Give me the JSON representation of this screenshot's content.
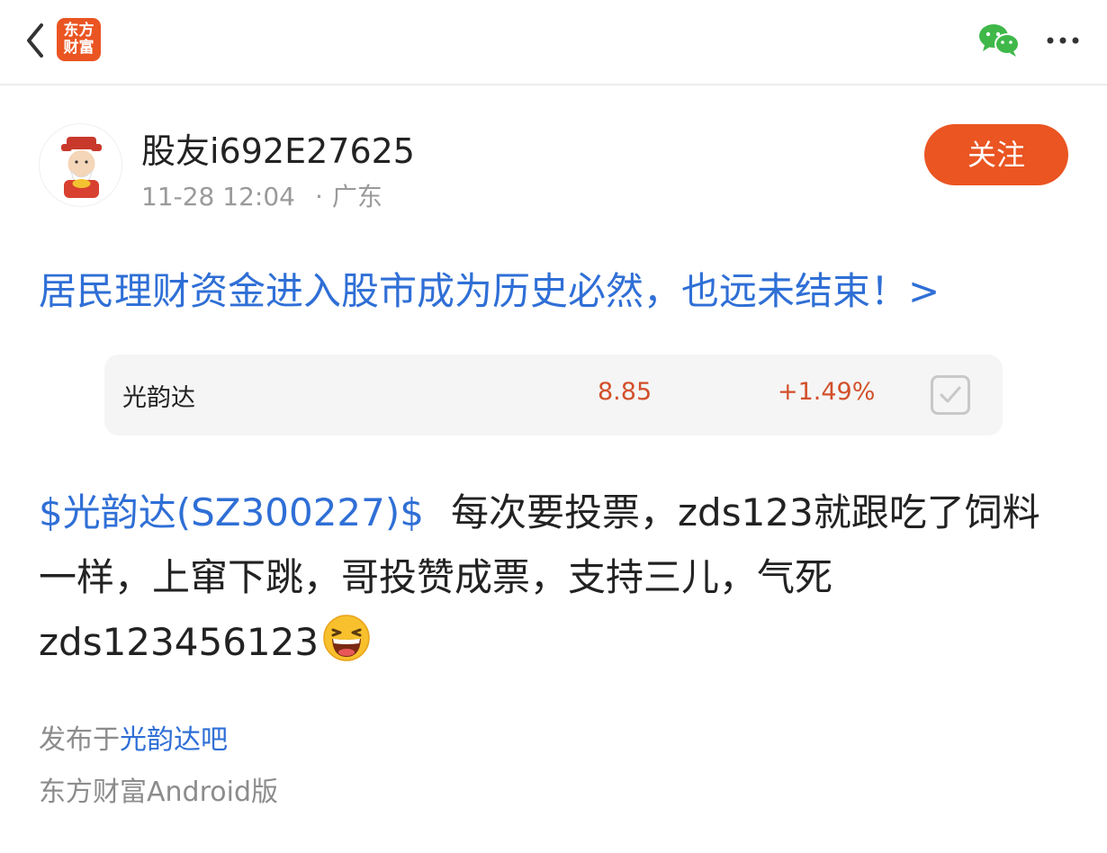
{
  "header": {
    "logo_line1": "东方",
    "logo_line2": "财富",
    "brand_color": "#ea5522"
  },
  "author": {
    "name": "股友i692E27625",
    "time": "11-28 12:04",
    "separator": "·",
    "location": "广东",
    "follow_label": "关注"
  },
  "headline": {
    "text": "居民理财资金进入股市成为历史必然，也远未结束！>",
    "color": "#2f6fd6"
  },
  "stock_card": {
    "name": "光韵达",
    "price": "8.85",
    "change": "+1.49%",
    "up_color": "#d2502b"
  },
  "post": {
    "stock_tag": "$光韵达(SZ300227)$",
    "text": "每次要投票，zds123就跟吃了饲料一样，上窜下跳，哥投赞成票，支持三儿，气死zds123456123",
    "emoji": "laughing-face-emoji"
  },
  "footer": {
    "publish_prefix": "发布于",
    "bar_name": "光韵达吧",
    "source": "东方财富Android版"
  }
}
